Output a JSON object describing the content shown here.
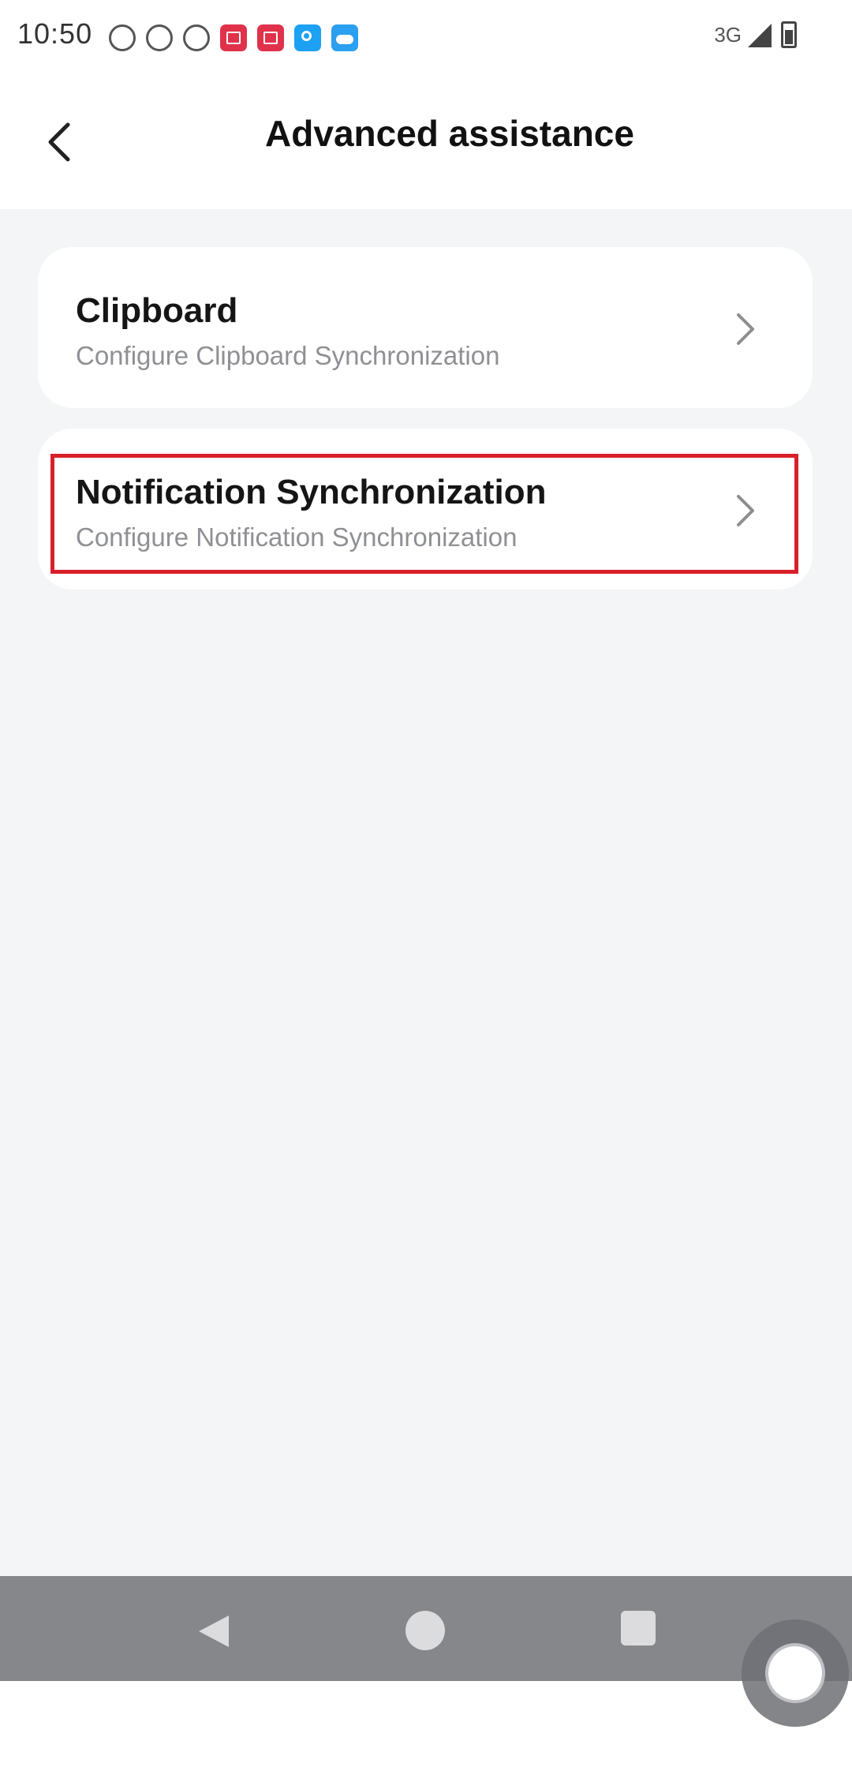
{
  "status_bar": {
    "time": "10:50",
    "network_label": "3G",
    "notification_icons": [
      "person-icon",
      "p-icon",
      "chat-icon",
      "red-app-icon",
      "shopping-bag-icon",
      "search-app-icon",
      "weather-icon"
    ],
    "system_icons": [
      "signal-icon",
      "battery-icon"
    ]
  },
  "header": {
    "back_icon": "chevron-left-icon",
    "title": "Advanced assistance"
  },
  "settings": [
    {
      "title": "Clipboard",
      "subtitle": "Configure Clipboard Synchronization",
      "icon": "chevron-right-icon"
    },
    {
      "title": "Notification Synchronization",
      "subtitle": "Configure Notification Synchronization",
      "icon": "chevron-right-icon",
      "highlighted": true
    }
  ],
  "navigation_bar": {
    "buttons": [
      "back-triangle-icon",
      "home-circle-icon",
      "recents-square-icon"
    ]
  },
  "colors": {
    "background": "#f3f5f6",
    "card": "#ffffff",
    "highlight": "#d8202a",
    "nav_bar": "#85878b"
  }
}
